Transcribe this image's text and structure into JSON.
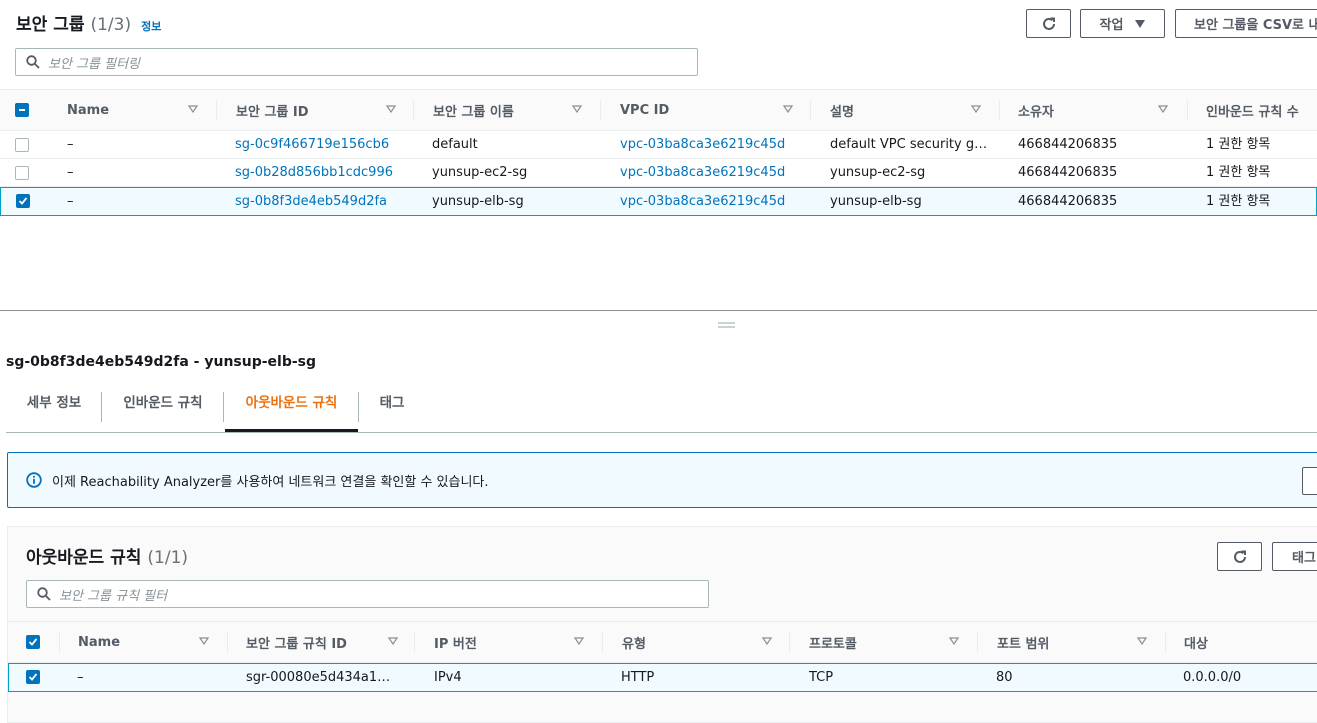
{
  "security_groups": {
    "title": "보안 그룹",
    "count": "(1/3)",
    "info_link": "정보",
    "actions_label": "작업",
    "export_label": "보안 그룹을 CSV로 내",
    "filter_placeholder": "보안 그룹 필터링",
    "columns": [
      "Name",
      "보안 그룹 ID",
      "보안 그룹 이름",
      "VPC ID",
      "설명",
      "소유자",
      "인바운드 규칙 수"
    ],
    "rows": [
      {
        "selected": false,
        "name": "–",
        "group_id": "sg-0c9f466719e156cb6",
        "group_name": "default",
        "vpc_id": "vpc-03ba8ca3e6219c45d",
        "description": "default VPC security gr…",
        "owner": "466844206835",
        "inbound": "1 권한 항목"
      },
      {
        "selected": false,
        "name": "–",
        "group_id": "sg-0b28d856bb1cdc996",
        "group_name": "yunsup-ec2-sg",
        "vpc_id": "vpc-03ba8ca3e6219c45d",
        "description": "yunsup-ec2-sg",
        "owner": "466844206835",
        "inbound": "1 권한 항목"
      },
      {
        "selected": true,
        "name": "–",
        "group_id": "sg-0b8f3de4eb549d2fa",
        "group_name": "yunsup-elb-sg",
        "vpc_id": "vpc-03ba8ca3e6219c45d",
        "description": "yunsup-elb-sg",
        "owner": "466844206835",
        "inbound": "1 권한 항목"
      }
    ]
  },
  "detail": {
    "title": "sg-0b8f3de4eb549d2fa - yunsup-elb-sg",
    "tabs": [
      "세부 정보",
      "인바운드 규칙",
      "아웃바운드 규칙",
      "태그"
    ],
    "active_tab": "아웃바운드 규칙",
    "banner_text": "이제 Reachability Analyzer를 사용하여 네트워크 연결을 확인할 수 있습니다.",
    "rules": {
      "title": "아웃바운드 규칙",
      "count": "(1/1)",
      "tags_button": "태그",
      "filter_placeholder": "보안 그룹 규칙 필터",
      "columns": [
        "Name",
        "보안 그룹 규칙 ID",
        "IP 버전",
        "유형",
        "프로토콜",
        "포트 범위",
        "대상"
      ],
      "rows": [
        {
          "selected": true,
          "name": "–",
          "rule_id": "sgr-00080e5d434a1d…",
          "ip_version": "IPv4",
          "type": "HTTP",
          "protocol": "TCP",
          "port_range": "80",
          "destination": "0.0.0.0/0"
        }
      ]
    }
  },
  "colors": {
    "link": "#0073bb",
    "active_tab": "#ec7211",
    "selected_row_border": "#00a1c9",
    "selected_row_bg": "#f1faff"
  }
}
